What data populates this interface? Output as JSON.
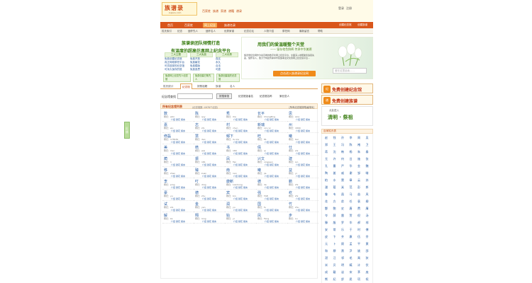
{
  "logo": {
    "text": "族谱录",
    "sub": "zupulu.com"
  },
  "top_links": [
    "百家姓",
    "族谱",
    "家谱",
    "谱籍",
    "谱录"
  ],
  "login_links": [
    "登录",
    "注册"
  ],
  "nav": {
    "items": [
      "首页",
      "百家姓",
      "网上纪念",
      "族谱名录"
    ],
    "active_index": 2,
    "right": [
      "创建纪念馆",
      "创建族谱"
    ]
  },
  "subnav": [
    "姓氏索引",
    "纪念",
    "缅怀先人",
    "缅怀名人",
    "优秀家谱",
    "纪念论坛",
    "人物介绍",
    "祭祀网",
    "最新留言",
    "帮助"
  ],
  "promo": {
    "title1": "族谱录团队倾情打造",
    "title2": "有温度的超高仿真网上纪念平台",
    "columns": [
      {
        "head": "三大主题",
        "items": [
          "免费创建纪念馆",
          "真正网络祭祀平台",
          "可供选择的纪念馆",
          "可永久保存的馆"
        ]
      },
      {
        "head": "三大免费",
        "items": [
          "免费开放",
          "免费献花",
          "免费模版",
          "免费追思"
        ]
      },
      {
        "head": "三大优势",
        "items": [
          "真实",
          "永久",
          "合法",
          "可靠"
        ]
      }
    ],
    "buttons": [
      "免费网上纪念先人纪念馆",
      "免费创建已故先人",
      "免费创建祖先纪念馆"
    ]
  },
  "promo_right": {
    "title": "用我们的爱温暖整个天堂",
    "sub": "—— 留存他色鲜辉  传承中华美德",
    "text": "族谱录纪念网作为最高端的数字化网上纪念平台，全面深入地帮助您追思先辈、缅怀亲人，致力于构建传承中华民族孝道文化的网上纪念馆平台...",
    "button": "点击进入族谱录纪念网",
    "search_placeholder": "爱在这里延续......"
  },
  "tabs": [
    "姓氏统计",
    "纪念馆",
    "按照祖籍",
    "族谱",
    "名人"
  ],
  "search": {
    "label": "纪念馆查找",
    "button": "按搜索馆",
    "radios": [
      "纪念馆逝者名",
      "纪念馆名称",
      "家纪念人"
    ]
  },
  "list": {
    "title": "所有纪念馆列表",
    "meta": "(纪念馆数: 4978个纪念)",
    "right": "[所有纪念馆按笔画排序]"
  },
  "memorials": [
    {
      "name": "数",
      "sub": "祭扫：wiki",
      "acts": [
        "介绍",
        "献花",
        "留言"
      ]
    },
    {
      "name": "陈",
      "sub": "祭扫：quy",
      "acts": [
        "介绍",
        "献花",
        "留言"
      ]
    },
    {
      "name": "秀",
      "sub": "祭扫：Xia",
      "acts": [
        "介绍",
        "献花",
        "留言"
      ]
    },
    {
      "name": "长平",
      "sub": "祭扫：ChangPing",
      "acts": [
        "介绍",
        "献花",
        "留言"
      ]
    },
    {
      "name": "思",
      "sub": "祭扫：sina",
      "acts": [
        "介绍",
        "献花",
        "留言"
      ]
    },
    {
      "name": "嘉",
      "sub": "祭扫：wu",
      "acts": [
        "介绍",
        "献花",
        "留言"
      ]
    },
    {
      "name": "志",
      "sub": "祭扫：zhi",
      "acts": [
        "介绍",
        "献花",
        "留言"
      ]
    },
    {
      "name": "村",
      "sub": "祭扫：chun",
      "acts": [
        "介绍",
        "献花",
        "留言"
      ]
    },
    {
      "name": "新瑞",
      "sub": "祭扫：xin rui",
      "acts": [
        "介绍",
        "献花",
        "留言"
      ]
    },
    {
      "name": "州",
      "sub": "祭扫：1809",
      "acts": [
        "介绍",
        "献花",
        "留言"
      ]
    },
    {
      "name": "修磊",
      "sub": "祭扫：178181",
      "acts": [
        "介绍",
        "献花",
        "留言"
      ]
    },
    {
      "name": "慧",
      "sub": "祭扫：dao",
      "acts": [
        "介绍",
        "献花",
        "留言"
      ]
    },
    {
      "name": "郁下",
      "sub": "祭扫：liu xia",
      "acts": [
        "介绍",
        "献花",
        "留言"
      ]
    },
    {
      "name": "旺",
      "sub": "祭扫：81",
      "acts": [
        "介绍",
        "献花",
        "留言"
      ]
    },
    {
      "name": "曦",
      "sub": "祭扫：bai",
      "acts": [
        "介绍",
        "献花",
        "留言"
      ]
    },
    {
      "name": "美",
      "sub": "祭扫：mei",
      "acts": [
        "介绍",
        "献花",
        "留言"
      ]
    },
    {
      "name": "皓",
      "sub": "祭扫：wei",
      "acts": [
        "介绍",
        "献花",
        "留言"
      ]
    },
    {
      "name": "书",
      "sub": "祭扫：180",
      "acts": [
        "介绍",
        "献花",
        "留言"
      ]
    },
    {
      "name": "倩",
      "sub": "祭扫：qi",
      "acts": [
        "介绍",
        "献花",
        "留言"
      ]
    },
    {
      "name": "仕",
      "sub": "祭扫：shi",
      "acts": [
        "介绍",
        "献花",
        "留言"
      ]
    },
    {
      "name": "蔺",
      "sub": "祭扫：li",
      "acts": [
        "介绍",
        "献花",
        "留言"
      ]
    },
    {
      "name": "振",
      "sub": "祭扫：181",
      "acts": [
        "介绍",
        "献花",
        "留言"
      ]
    },
    {
      "name": "凤",
      "sub": "祭扫：Fan",
      "acts": [
        "介绍",
        "献花",
        "留言"
      ]
    },
    {
      "name": "兴文",
      "sub": "祭扫：xingwen",
      "acts": [
        "介绍",
        "献花",
        "留言"
      ]
    },
    {
      "name": "建",
      "sub": "祭扫：Lin",
      "acts": [
        "介绍",
        "献花",
        "留言"
      ]
    },
    {
      "name": "移",
      "sub": "祭扫：zhen",
      "acts": [
        "介绍",
        "献花",
        "留言"
      ]
    },
    {
      "name": "臻",
      "sub": "祭扫：kuan",
      "acts": [
        "介绍",
        "献花",
        "留言"
      ]
    },
    {
      "name": "南",
      "sub": "祭扫：nan",
      "acts": [
        "介绍",
        "献花",
        "留言"
      ]
    },
    {
      "name": "曦",
      "sub": "祭扫：jia",
      "acts": [
        "介绍",
        "献花",
        "留言"
      ]
    },
    {
      "name": "益",
      "sub": "祭扫：yi",
      "acts": [
        "介绍",
        "献花",
        "留言"
      ]
    },
    {
      "name": "李",
      "sub": "祭扫：ping",
      "acts": [
        "介绍",
        "献花",
        "留言"
      ]
    },
    {
      "name": "叮",
      "sub": "祭扫：ding",
      "acts": [
        "介绍",
        "献花",
        "留言"
      ]
    },
    {
      "name": "康断",
      "sub": "祭扫：Lianhong",
      "acts": [
        "介绍",
        "献花",
        "留言"
      ]
    },
    {
      "name": "德",
      "sub": "祭扫：de",
      "acts": [
        "介绍",
        "献花",
        "留言"
      ]
    },
    {
      "name": "鹏",
      "sub": "祭扫：zhi",
      "acts": [
        "介绍",
        "献花",
        "留言"
      ]
    },
    {
      "name": "豪",
      "sub": "祭扫：yu",
      "acts": [
        "介绍",
        "献花",
        "留言"
      ]
    },
    {
      "name": "德",
      "sub": "祭扫：zhu",
      "acts": [
        "介绍",
        "献花",
        "留言"
      ]
    },
    {
      "name": "宾",
      "sub": "祭扫：bin",
      "acts": [
        "介绍",
        "献花",
        "留言"
      ]
    },
    {
      "name": "强",
      "sub": "祭扫：TAB",
      "acts": [
        "介绍",
        "献花",
        "留言"
      ]
    },
    {
      "name": "屹",
      "sub": "祭扫：zhi",
      "acts": [
        "介绍",
        "献花",
        "留言"
      ]
    },
    {
      "name": "试",
      "sub": "祭扫：shi",
      "acts": [
        "介绍",
        "献花",
        "留言"
      ]
    },
    {
      "name": "金",
      "sub": "祭扫：yan",
      "acts": [
        "介绍",
        "献花",
        "留言"
      ]
    },
    {
      "name": "润",
      "sub": "祭扫：yu",
      "acts": [
        "介绍",
        "献花",
        "留言"
      ]
    },
    {
      "name": "国",
      "sub": "祭扫：fu",
      "acts": [
        "介绍",
        "献花",
        "留言"
      ]
    },
    {
      "name": "竹",
      "sub": "祭扫：zhu",
      "acts": [
        "介绍",
        "献花",
        "留言"
      ]
    },
    {
      "name": "解",
      "sub": "祭扫：ke",
      "acts": [
        "介绍",
        "献花",
        "留言"
      ]
    },
    {
      "name": "翔",
      "sub": "祭扫：long",
      "acts": [
        "介绍",
        "献花",
        "留言"
      ]
    },
    {
      "name": "始",
      "sub": "祭扫：yi",
      "acts": [
        "介绍",
        "献花",
        "留言"
      ]
    },
    {
      "name": "凤",
      "sub": "祭扫：Feng",
      "acts": [
        "介绍",
        "献花",
        "留言"
      ]
    },
    {
      "name": "步",
      "sub": "祭扫：su",
      "acts": [
        "介绍",
        "献花",
        "留言"
      ]
    }
  ],
  "right": {
    "btn1": "免费创建纪念馆",
    "btn2": "免费创建族谱",
    "qm_small": "点此进入",
    "qm_big": "清明 · 祭祖",
    "surname_title": "百家姓氏表",
    "surnames": [
      "赵",
      "钱",
      "孙",
      "李",
      "周",
      "吴",
      "郑",
      "王",
      "冯",
      "陈",
      "褚",
      "卫",
      "蒋",
      "沈",
      "韩",
      "杨",
      "朱",
      "秦",
      "尤",
      "许",
      "何",
      "吕",
      "施",
      "张",
      "孔",
      "曹",
      "严",
      "华",
      "金",
      "魏",
      "陶",
      "姜",
      "戚",
      "谢",
      "邹",
      "喻",
      "柏",
      "水",
      "窦",
      "章",
      "云",
      "苏",
      "潘",
      "葛",
      "奚",
      "范",
      "彭",
      "郎",
      "鲁",
      "韦",
      "昌",
      "马",
      "苗",
      "凤",
      "花",
      "方",
      "俞",
      "任",
      "袁",
      "柳",
      "酆",
      "鲍",
      "史",
      "唐",
      "费",
      "廉",
      "岑",
      "薛",
      "雷",
      "贺",
      "倪",
      "汤",
      "滕",
      "殷",
      "罗",
      "毕",
      "郝",
      "邬",
      "安",
      "常",
      "乐",
      "于",
      "时",
      "傅",
      "皮",
      "卞",
      "齐",
      "康",
      "伍",
      "余",
      "元",
      "卜",
      "顾",
      "孟",
      "平",
      "黄",
      "和",
      "穆",
      "萧",
      "尹",
      "姚",
      "邵",
      "湛",
      "汪",
      "祁",
      "毛",
      "禹",
      "狄",
      "米",
      "贝",
      "明",
      "臧",
      "计",
      "伏",
      "成",
      "戴",
      "谈",
      "宋",
      "茅",
      "庞",
      "熊",
      "纪",
      "舒",
      "屈",
      "项",
      "祝",
      "董",
      "梁"
    ]
  }
}
